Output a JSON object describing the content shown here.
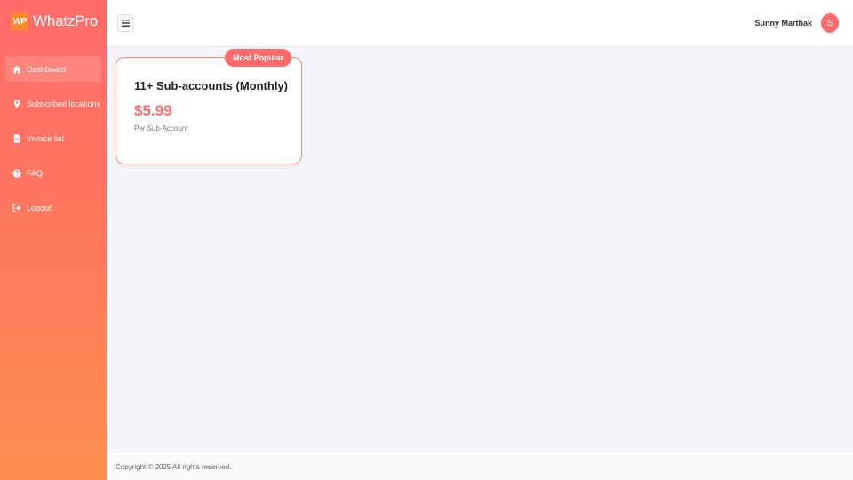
{
  "brand": {
    "logo_text": "WP",
    "name": "WhatzPro"
  },
  "sidebar": {
    "items": [
      {
        "label": "Dashboard",
        "icon": "home-icon",
        "active": true
      },
      {
        "label": "Subscribed locations",
        "icon": "map-pin-icon",
        "active": false
      },
      {
        "label": "Invoice list",
        "icon": "file-icon",
        "active": false
      },
      {
        "label": "FAQ",
        "icon": "question-circle-icon",
        "active": false
      },
      {
        "label": "Logout",
        "icon": "logout-icon",
        "active": false
      }
    ]
  },
  "header": {
    "menu_icon": "hamburger-icon",
    "user_name": "Sunny Marthak",
    "avatar_initial": "S"
  },
  "plan_card": {
    "badge": "Most Popular",
    "title": "11+ Sub-accounts (Monthly)",
    "price": "$5.99",
    "unit": "Per Sub-Account"
  },
  "footer": {
    "text": "Copyright © 2025 All rights reserved."
  },
  "colors": {
    "accent": "#ff6b6b",
    "sidebar_top": "#ff6b6b",
    "sidebar_bottom": "#ff8f50",
    "card_border": "#ff8a6e",
    "background": "#f4f5fa"
  }
}
